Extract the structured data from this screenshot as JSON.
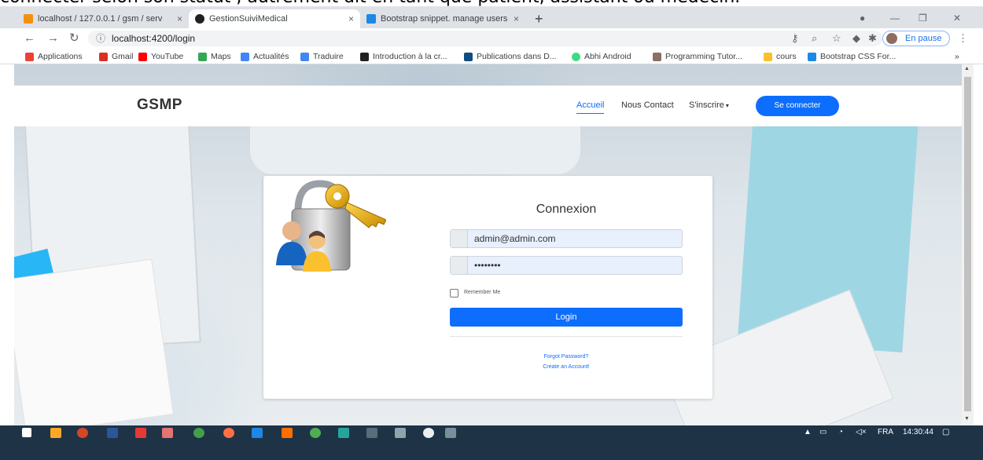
{
  "caption": "connecter selon son statut , autrement dit en tant que patient, assistant ou médecin.",
  "browser": {
    "tabs": [
      {
        "title": "localhost / 127.0.0.1 / gsm / serv",
        "favicon_color": "#f29111"
      },
      {
        "title": "GestionSuiviMedical",
        "favicon_color": "#202124"
      },
      {
        "title": "Bootstrap snippet. manage users",
        "favicon_color": "#1e88e5"
      }
    ],
    "tab_close": "×",
    "new_tab": "+",
    "url": "localhost:4200/login",
    "pause_label": "En pause",
    "bookmarks": [
      {
        "label": "Applications",
        "color": "#ea4335"
      },
      {
        "label": "Gmail",
        "color": "#d93025"
      },
      {
        "label": "YouTube",
        "color": "#ff0000"
      },
      {
        "label": "Maps",
        "color": "#34a853"
      },
      {
        "label": "Actualités",
        "color": "#4285f4"
      },
      {
        "label": "Traduire",
        "color": "#4285f4"
      },
      {
        "label": "Introduction à la cr...",
        "color": "#202124"
      },
      {
        "label": "Publications dans D...",
        "color": "#0f4c81"
      },
      {
        "label": "Abhi Android",
        "color": "#3ddc84"
      },
      {
        "label": "Programming Tutor...",
        "color": "#8d6e63"
      },
      {
        "label": "cours",
        "color": "#fbc02d"
      },
      {
        "label": "Bootstrap CSS For...",
        "color": "#1e88e5"
      }
    ],
    "more_bookmarks": "»"
  },
  "site": {
    "brand": "GSMP",
    "nav": {
      "home": "Accueil",
      "contact": "Nous Contact",
      "signup": "S'inscrire",
      "connect": "Se connecter"
    }
  },
  "login": {
    "title": "Connexion",
    "email_value": "admin@admin.com",
    "password_value": "••••••••",
    "remember_label": "Remember Me",
    "submit_label": "Login",
    "forgot_label": "Forgot Password?",
    "create_label": "Create an Account!"
  },
  "taskbar": {
    "tray_text": "FRA",
    "time": "14:30:44"
  },
  "colors": {
    "primary": "#0d6efd",
    "taskbar": "#1f3347",
    "chrome": "#dee1e6"
  }
}
